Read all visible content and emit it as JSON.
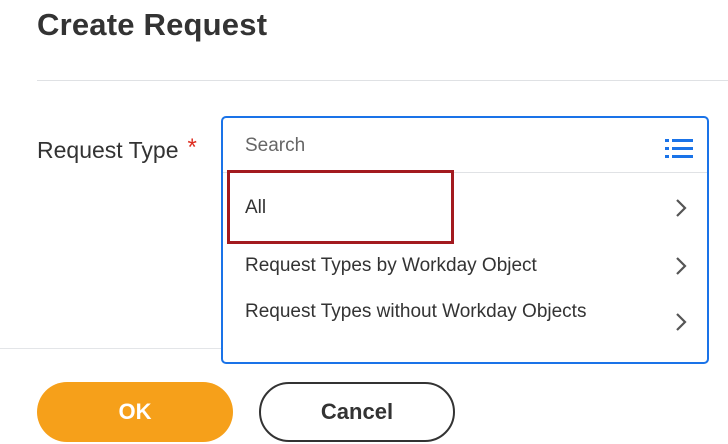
{
  "page": {
    "title": "Create Request"
  },
  "form": {
    "request_type_label": "Request Type",
    "required_marker": "*"
  },
  "prompt": {
    "search_placeholder": "Search",
    "search_value": "",
    "list_icon": "list-icon",
    "items": [
      {
        "label": "All",
        "icon": "chevron-right-icon"
      },
      {
        "label": "Request Types by Workday Object",
        "icon": "chevron-right-icon"
      },
      {
        "label": "Request Types without Workday Objects",
        "icon": "chevron-right-icon"
      }
    ]
  },
  "actions": {
    "ok_label": "OK",
    "cancel_label": "Cancel"
  },
  "colors": {
    "accent_blue": "#1a73e8",
    "ok_orange": "#f6a01a",
    "required_red": "#de2e21",
    "highlight_red": "#a31a1f"
  }
}
